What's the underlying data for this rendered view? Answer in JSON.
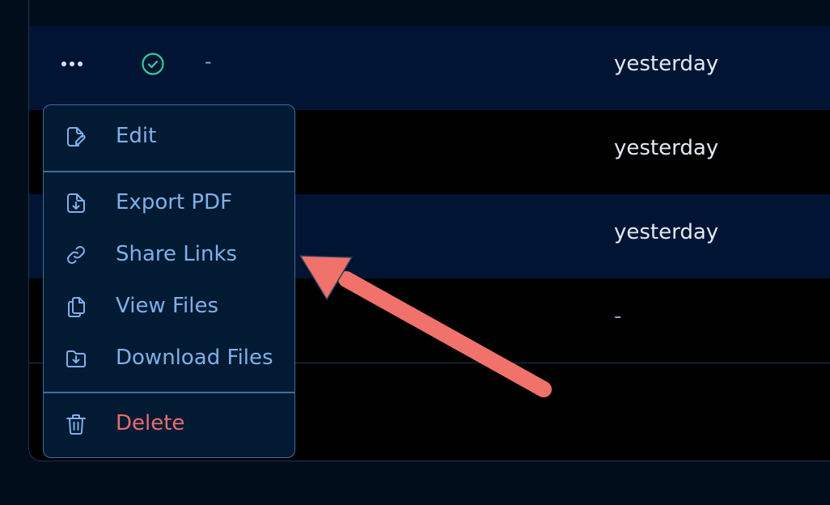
{
  "rows": [
    {
      "status": "-",
      "time": "yesterday",
      "has_actions": true
    },
    {
      "time": "yesterday"
    },
    {
      "time": "yesterday"
    },
    {
      "time": "-"
    }
  ],
  "menu": {
    "items": [
      {
        "label": "Edit",
        "icon": "edit-icon"
      },
      {
        "label": "Export PDF",
        "icon": "export-pdf-icon"
      },
      {
        "label": "Share Links",
        "icon": "link-icon"
      },
      {
        "label": "View Files",
        "icon": "files-icon"
      },
      {
        "label": "Download Files",
        "icon": "download-folder-icon"
      },
      {
        "label": "Delete",
        "icon": "trash-icon"
      }
    ]
  },
  "colors": {
    "background": "#020d1b",
    "row_navy": "#011433",
    "menu_bg": "#031a33",
    "menu_border": "#3f6ea3",
    "menu_text": "#7fb0eb",
    "danger_text": "#e76d6d",
    "success_icon": "#2fcf98",
    "annotation_arrow": "#f0726a"
  }
}
